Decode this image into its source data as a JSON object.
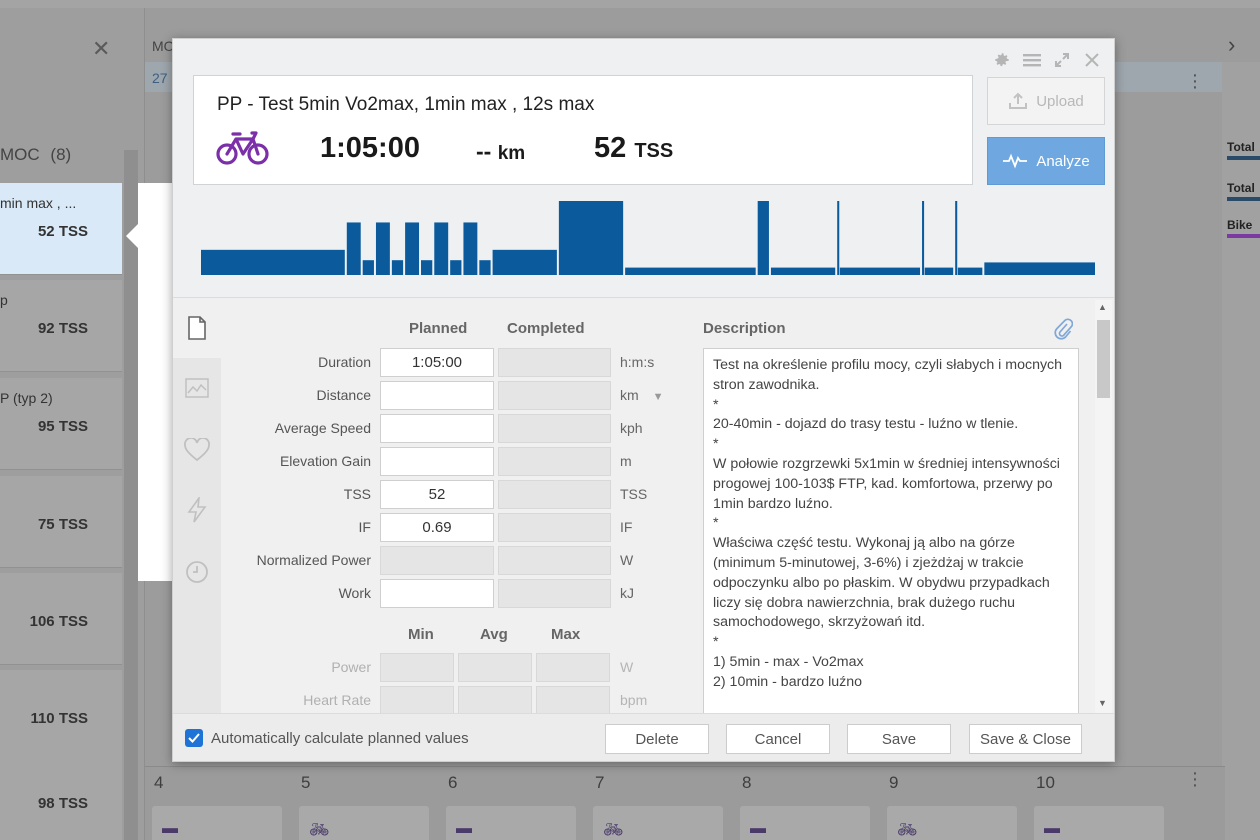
{
  "background": {
    "left_panel": {
      "title": "MOC",
      "count": "(8)",
      "cards": [
        {
          "title": "min max , ...",
          "tss": "52 TSS"
        },
        {
          "title": "p",
          "tss": "92 TSS"
        },
        {
          "title": "P (typ 2)",
          "tss": "95 TSS"
        },
        {
          "title": "",
          "tss": "75 TSS"
        },
        {
          "title": "",
          "tss": "106 TSS"
        },
        {
          "title": "",
          "tss": "110 TSS"
        },
        {
          "title": "",
          "tss": "98 TSS"
        }
      ]
    },
    "calendar": {
      "header_text": "MO",
      "header_num": "27",
      "right_labels": [
        "Total",
        "Total",
        "Bike"
      ],
      "right_colors": [
        "#2a4a6a",
        "#2a4a6a",
        "#7a3aa0"
      ],
      "days": [
        "4",
        "5",
        "6",
        "7",
        "8",
        "9",
        "10"
      ]
    }
  },
  "workout": {
    "title": "PP - Test 5min Vo2max, 1min max , 12s max",
    "duration": "1:05:00",
    "distance": "--",
    "distance_unit": "km",
    "tss": "52",
    "tss_unit": "TSS",
    "sport_color": "#7b2fa8",
    "graph_color": "#0a5a9c",
    "graph_profile": [
      {
        "d": 11,
        "p": 0.34
      },
      {
        "d": 1.2,
        "p": 0.71
      },
      {
        "d": 1,
        "p": 0.2
      },
      {
        "d": 1.2,
        "p": 0.71
      },
      {
        "d": 1,
        "p": 0.2
      },
      {
        "d": 1.2,
        "p": 0.71
      },
      {
        "d": 1,
        "p": 0.2
      },
      {
        "d": 1.2,
        "p": 0.71
      },
      {
        "d": 1,
        "p": 0.2
      },
      {
        "d": 1.2,
        "p": 0.71
      },
      {
        "d": 1,
        "p": 0.2
      },
      {
        "d": 5,
        "p": 0.34
      },
      {
        "d": 5,
        "p": 1.0
      },
      {
        "d": 10,
        "p": 0.1
      },
      {
        "d": 1,
        "p": 1.0
      },
      {
        "d": 5,
        "p": 0.1
      },
      {
        "d": 0.2,
        "p": 1.0
      },
      {
        "d": 6.2,
        "p": 0.1
      },
      {
        "d": 0.2,
        "p": 1.0
      },
      {
        "d": 2.3,
        "p": 0.1
      },
      {
        "d": 0.2,
        "p": 1.0
      },
      {
        "d": 2,
        "p": 0.1
      },
      {
        "d": 8.5,
        "p": 0.17
      }
    ]
  },
  "actions": {
    "upload": "Upload",
    "analyze": "Analyze"
  },
  "form": {
    "col_planned": "Planned",
    "col_completed": "Completed",
    "rows": [
      {
        "label": "Duration",
        "planned": "1:05:00",
        "completed": "",
        "unit": "h:m:s",
        "planned_enabled": true
      },
      {
        "label": "Distance",
        "planned": "",
        "completed": "",
        "unit": "km",
        "planned_enabled": true
      },
      {
        "label": "Average Speed",
        "planned": "",
        "completed": "",
        "unit": "kph",
        "planned_enabled": true
      },
      {
        "label": "Elevation Gain",
        "planned": "",
        "completed": "",
        "unit": "m",
        "planned_enabled": true
      },
      {
        "label": "TSS",
        "planned": "52",
        "completed": "",
        "unit": "TSS",
        "planned_enabled": true
      },
      {
        "label": "IF",
        "planned": "0.69",
        "completed": "",
        "unit": "IF",
        "planned_enabled": true
      },
      {
        "label": "Normalized Power",
        "planned": "",
        "completed": "",
        "unit": "W",
        "planned_enabled": false
      },
      {
        "label": "Work",
        "planned": "",
        "completed": "",
        "unit": "kJ",
        "planned_enabled": true
      }
    ],
    "mm_headers": [
      "Min",
      "Avg",
      "Max"
    ],
    "mm_rows": [
      {
        "label": "Power",
        "unit": "W"
      },
      {
        "label": "Heart Rate",
        "unit": "bpm"
      }
    ]
  },
  "description": {
    "heading": "Description",
    "text": "Test na określenie profilu mocy, czyli słabych i mocnych stron zawodnika.\n*\n20-40min - dojazd do trasy testu - luźno w tlenie.\n*\nW połowie rozgrzewki 5x1min w średniej intensywności progowej 100-103$ FTP, kad. komfortowa, przerwy po 1min bardzo luźno.\n*\nWłaściwa część testu. Wykonaj ją albo na górze (minimum 5-minutowej, 3-6%) i zjeżdżaj w trakcie odpoczynku albo po płaskim. W obydwu przypadkach liczy się dobra nawierzchnia, brak dużego ruchu samochodowego, skrzyżowań itd.\n*\n1) 5min - max - Vo2max\n2) 10min - bardzo luźno"
  },
  "footer": {
    "auto_calc_label": "Automatically calculate planned values",
    "auto_calc_checked": true,
    "delete": "Delete",
    "cancel": "Cancel",
    "save": "Save",
    "save_close": "Save & Close"
  }
}
